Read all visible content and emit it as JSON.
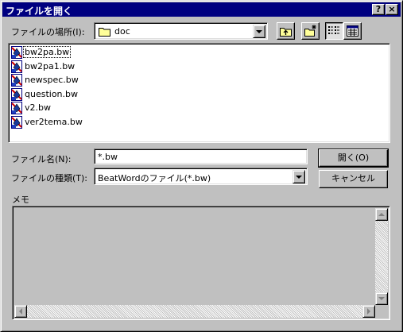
{
  "window": {
    "title": "ファイルを開く",
    "help_glyph": "?",
    "close_glyph": "×"
  },
  "location": {
    "label": "ファイルの場所(I):",
    "value": "doc"
  },
  "files": [
    {
      "name": "bw2pa.bw",
      "icon": "beatword-file-icon"
    },
    {
      "name": "bw2pa1.bw",
      "icon": "beatword-file-icon"
    },
    {
      "name": "newspec.bw",
      "icon": "beatword-file-icon"
    },
    {
      "name": "question.bw",
      "icon": "beatword-file-icon"
    },
    {
      "name": "v2.bw",
      "icon": "beatword-file-icon"
    },
    {
      "name": "ver2tema.bw",
      "icon": "beatword-file-icon"
    }
  ],
  "filename": {
    "label": "ファイル名(N):",
    "value": "*.bw"
  },
  "filetype": {
    "label": "ファイルの種類(T):",
    "value": "BeatWordのファイル(*.bw)"
  },
  "buttons": {
    "open": "開く(O)",
    "cancel": "キャンセル"
  },
  "memo": {
    "label": "メモ"
  },
  "colors": {
    "titlebar": "#000080",
    "face": "#c0c0c0"
  }
}
